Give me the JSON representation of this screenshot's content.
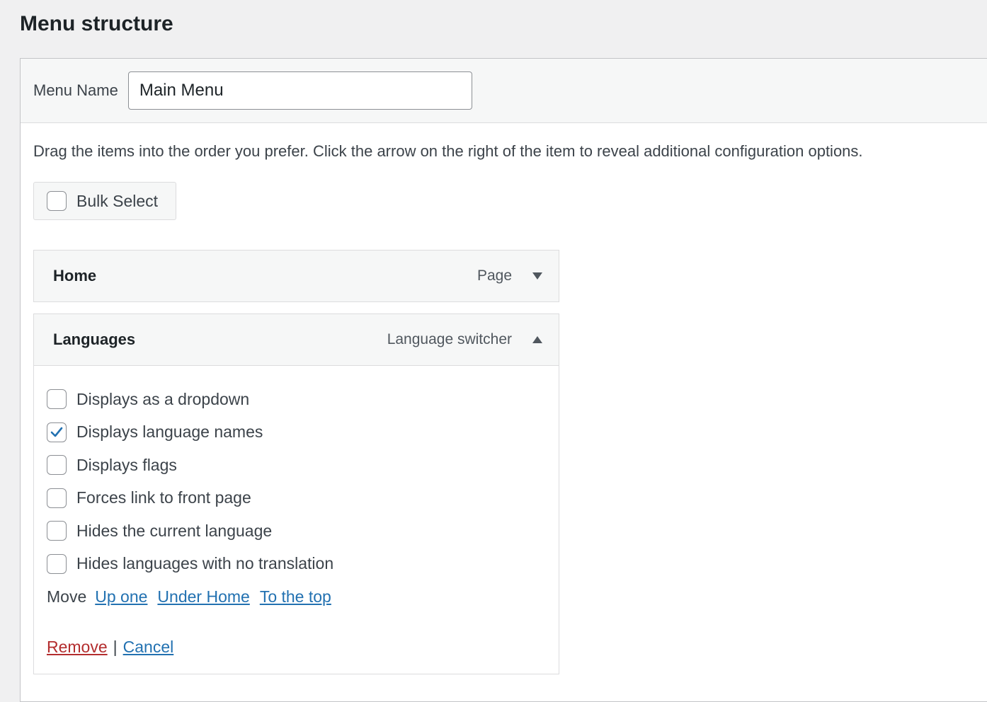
{
  "page": {
    "title": "Menu structure"
  },
  "menu_name": {
    "label": "Menu Name",
    "value": "Main Menu"
  },
  "instructions": "Drag the items into the order you prefer. Click the arrow on the right of the item to reveal additional configuration options.",
  "bulk_select": {
    "label": "Bulk Select",
    "checked": false
  },
  "items": [
    {
      "title": "Home",
      "type": "Page",
      "expanded": false,
      "toggle_icon": "triangle-down-icon"
    },
    {
      "title": "Languages",
      "type": "Language switcher",
      "expanded": true,
      "toggle_icon": "triangle-up-icon",
      "options": [
        {
          "label": "Displays as a dropdown",
          "checked": false
        },
        {
          "label": "Displays language names",
          "checked": true
        },
        {
          "label": "Displays flags",
          "checked": false
        },
        {
          "label": "Forces link to front page",
          "checked": false
        },
        {
          "label": "Hides the current language",
          "checked": false
        },
        {
          "label": "Hides languages with no translation",
          "checked": false
        }
      ],
      "move": {
        "label": "Move",
        "links": [
          "Up one",
          "Under Home",
          "To the top"
        ]
      },
      "actions": {
        "remove": "Remove",
        "separator": "|",
        "cancel": "Cancel"
      }
    }
  ],
  "colors": {
    "link": "#2271b1",
    "remove": "#b32d2e",
    "check": "#2271b1"
  }
}
